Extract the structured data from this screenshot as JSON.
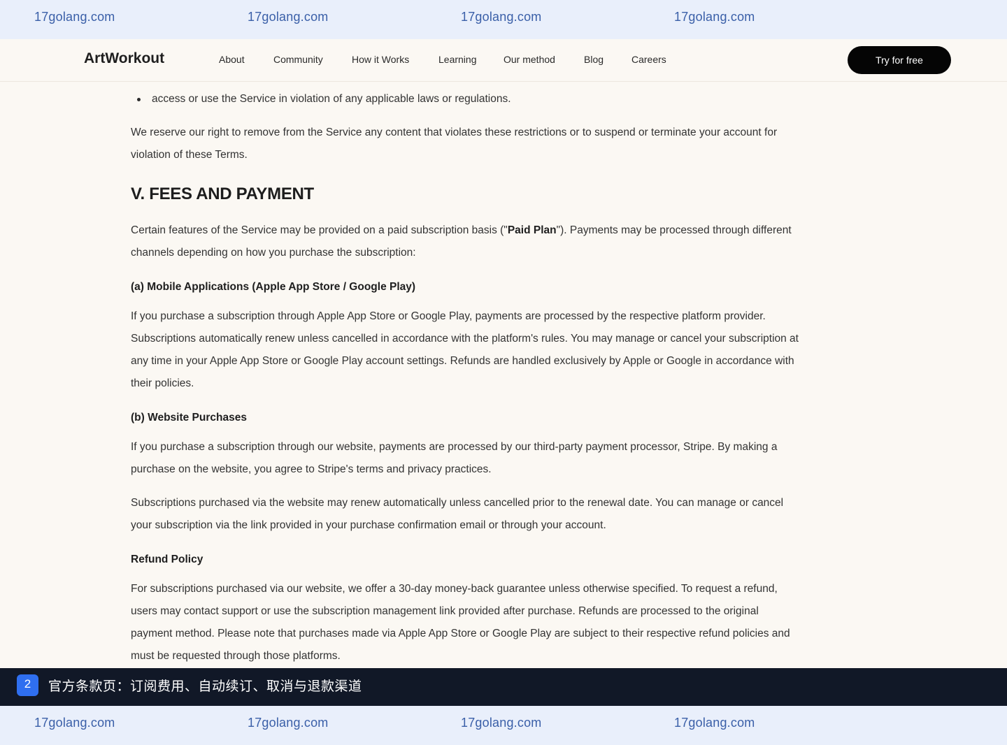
{
  "watermark": {
    "text": "17golang.com"
  },
  "nav": {
    "logo": "ArtWorkout",
    "links": [
      "About",
      "Community",
      "How it Works",
      "Learning",
      "Our method",
      "Blog",
      "Careers"
    ],
    "cta": "Try for free"
  },
  "content": {
    "clipped_line": "…………………………………………………………",
    "bullet_item": "access or use the Service in violation of any applicable laws or regulations.",
    "reserve_paragraph": "We reserve our right to remove from the Service any content that violates these restrictions or to suspend or terminate your account for violation of these Terms.",
    "section_title": "V. FEES AND PAYMENT",
    "intro_before": "Certain features of the Service may be provided on a paid subscription basis (\"",
    "intro_bold": "Paid Plan",
    "intro_after": "\"). Payments may be processed through different channels depending on how you purchase the subscription:",
    "mobile_heading": "(a) Mobile Applications (Apple App Store / Google Play)",
    "mobile_paragraph": "If you purchase a subscription through Apple App Store or Google Play, payments are processed by the respective platform provider. Subscriptions automatically renew unless cancelled in accordance with the platform's rules. You may manage or cancel your subscription at any time in your Apple App Store or Google Play account settings. Refunds are handled exclusively by Apple or Google in accordance with their policies.",
    "website_heading": "(b) Website Purchases",
    "website_paragraph_1": "If you purchase a subscription through our website, payments are processed by our third-party payment processor, Stripe. By making a purchase on the website, you agree to Stripe's terms and privacy practices.",
    "website_paragraph_2": "Subscriptions purchased via the website may renew automatically unless cancelled prior to the renewal date. You can manage or cancel your subscription via the link provided in your purchase confirmation email or through your account.",
    "refund_heading": "Refund Policy",
    "refund_paragraph": "For subscriptions purchased via our website, we offer a 30-day money-back guarantee unless otherwise specified. To request a refund, users may contact support or use the subscription management link provided after purchase. Refunds are processed to the original payment method. Please note that purchases made via Apple App Store or Google Play are subject to their respective refund policies and must be requested through those platforms."
  },
  "caption": {
    "badge": "2",
    "text": "官方条款页：订阅费用、自动续订、取消与退款渠道"
  },
  "colors": {
    "page_bg": "#fbf8f3",
    "watermark_bg": "#e9effb",
    "watermark_text": "#3a5fa8",
    "cta_bg": "#050505",
    "caption_bg": "#111827",
    "badge_bg": "#2f6ff0"
  }
}
